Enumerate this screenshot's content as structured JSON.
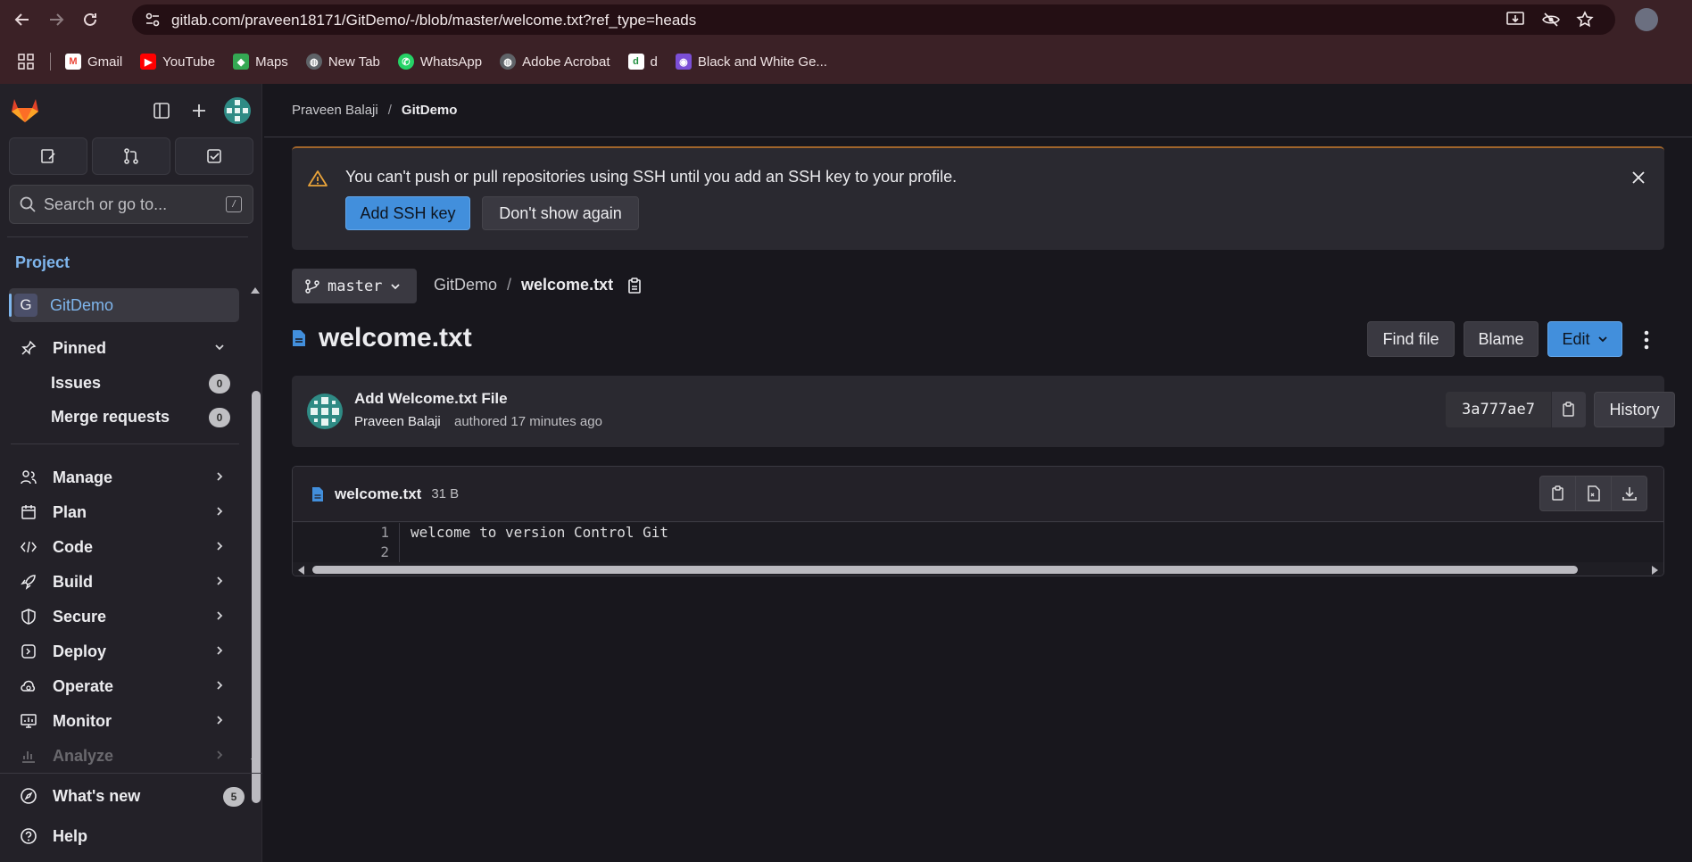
{
  "browser": {
    "url": "gitlab.com/praveen18171/GitDemo/-/blob/master/welcome.txt?ref_type=heads",
    "bookmarks": [
      {
        "label": "Gmail",
        "icon": "gmail-icon",
        "color": "#ea4335"
      },
      {
        "label": "YouTube",
        "icon": "youtube-icon",
        "color": "#ff0000"
      },
      {
        "label": "Maps",
        "icon": "maps-icon",
        "color": "#34a853"
      },
      {
        "label": "New Tab",
        "icon": "globe-icon",
        "color": "#5f6368"
      },
      {
        "label": "WhatsApp",
        "icon": "whatsapp-icon",
        "color": "#25d366"
      },
      {
        "label": "Adobe Acrobat",
        "icon": "globe-icon",
        "color": "#5f6368"
      },
      {
        "label": "d",
        "icon": "d-icon",
        "color": "#1e8e3e"
      },
      {
        "label": "Black and White Ge...",
        "icon": "bw-icon",
        "color": "#7b4fd6"
      }
    ]
  },
  "sidebar": {
    "search_placeholder": "Search or go to...",
    "kbd": "/",
    "section": "Project",
    "project": {
      "initial": "G",
      "name": "GitDemo"
    },
    "pinned": {
      "label": "Pinned",
      "items": [
        {
          "label": "Issues",
          "count": "0"
        },
        {
          "label": "Merge requests",
          "count": "0"
        }
      ]
    },
    "menu": [
      "Manage",
      "Plan",
      "Code",
      "Build",
      "Secure",
      "Deploy",
      "Operate",
      "Monitor",
      "Analyze"
    ],
    "whats_new": {
      "label": "What's new",
      "count": "5"
    },
    "help": "Help"
  },
  "breadcrumb": {
    "owner": "Praveen Balaji",
    "sep": "/",
    "project": "GitDemo"
  },
  "alert": {
    "text": "You can't push or pull repositories using SSH until you add an SSH key to your profile.",
    "primary": "Add SSH key",
    "secondary": "Don't show again"
  },
  "repo": {
    "branch": "master",
    "path_project": "GitDemo",
    "path_sep": "/",
    "path_file": "welcome.txt"
  },
  "file": {
    "title": "welcome.txt",
    "actions": {
      "find": "Find file",
      "blame": "Blame",
      "edit": "Edit"
    },
    "name": "welcome.txt",
    "size": "31 B",
    "lines": [
      {
        "n": "1",
        "text": "welcome to version Control Git"
      },
      {
        "n": "2",
        "text": ""
      }
    ]
  },
  "commit": {
    "title": "Add Welcome.txt File",
    "author": "Praveen Balaji",
    "meta": "authored 17 minutes ago",
    "sha": "3a777ae7",
    "history": "History"
  },
  "colors": {
    "accent": "#428fdc",
    "link": "#7fb6ed",
    "warning": "#a0652b",
    "brand": "#e24329"
  }
}
